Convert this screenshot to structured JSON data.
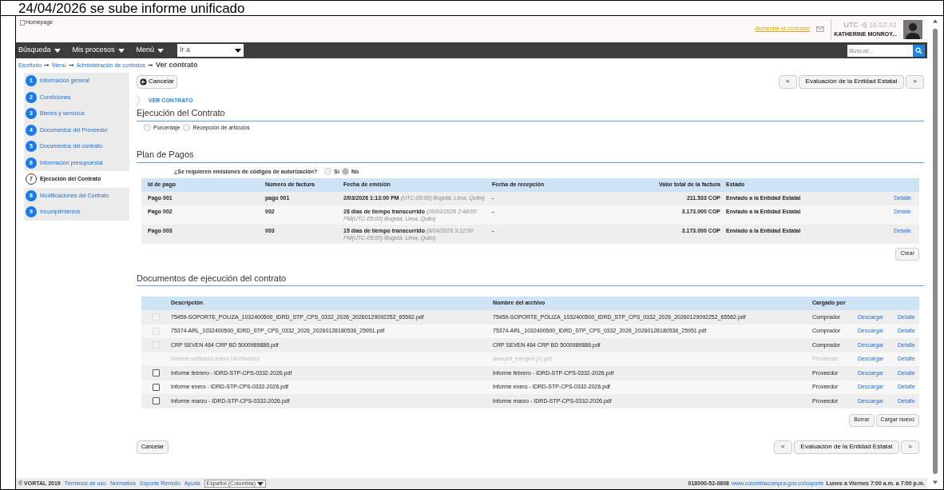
{
  "caption": "24/04/2026 se sube informe unificado",
  "header": {
    "logo_alt": "Homepage",
    "contrast_link": "Aumentar el contraste",
    "timezone": "UTC -5",
    "time": "16:52:41",
    "user": "KATHERINE MONROY..."
  },
  "nav": {
    "menus": [
      "Búsqueda",
      "Mis procesos",
      "Menú"
    ],
    "goto_value": "Ir a",
    "search_placeholder": "Buscar..."
  },
  "breadcrumb": {
    "separator": "➞",
    "links": [
      "Escritorio",
      "Menú",
      "Administración de contratos"
    ],
    "current": "Ver contrato"
  },
  "steps": [
    {
      "number": "1",
      "label": "Información general",
      "selected": false
    },
    {
      "number": "2",
      "label": "Condiciones",
      "selected": false
    },
    {
      "number": "3",
      "label": "Bienes y servicios",
      "selected": false
    },
    {
      "number": "4",
      "label": "Documentos del Proveedor",
      "selected": false
    },
    {
      "number": "5",
      "label": "Documentos del contrato",
      "selected": false
    },
    {
      "number": "6",
      "label": "Información presupuestal",
      "selected": false
    },
    {
      "number": "7",
      "label": "Ejecución del Contrato",
      "selected": true
    },
    {
      "number": "8",
      "label": "Modificaciones del Contrato",
      "selected": false
    },
    {
      "number": "9",
      "label": "Incumplimientos",
      "selected": false
    }
  ],
  "cancel_button": "Cancelar",
  "pager": {
    "prev": "<",
    "label": "Evaluación de la Entidad Estatal",
    "next": ">"
  },
  "section_tag": "VER CONTRATO",
  "execution": {
    "title": "Ejecución del Contrato",
    "options": [
      {
        "label": "Porcentaje",
        "selected": false
      },
      {
        "label": "Recepción de artículos",
        "selected": false
      }
    ]
  },
  "payments": {
    "title": "Plan de Pagos",
    "question": "¿Se requieren emisiones de códigos de autorización?",
    "answers": [
      {
        "label": "Sí",
        "selected": false
      },
      {
        "label": "No",
        "selected": true
      }
    ],
    "columns": [
      "Id de pago",
      "Número de factura",
      "Fecha de emisión",
      "Fecha de recepción",
      "Valor total de la factura",
      "Estado"
    ],
    "rows": [
      {
        "id": "Pago 001",
        "invoice": "pago 001",
        "issued": "2/03/2026 1:13:00 PM",
        "issued_note": "(UTC-05:00) Bogotá, Lima, Quito)",
        "received": "-",
        "total": "211.533 COP",
        "status": "Enviado a la Entidad Estatal",
        "link": "Detalle"
      },
      {
        "id": "Pago 002",
        "invoice": "002",
        "issued": "28 días de tiempo transcurrido",
        "issued_note": "(26/03/2026 2:48:00 PM(UTC-05:00) Bogotá, Lima, Quito)",
        "received": "-",
        "total": "3.173.000 COP",
        "status": "Enviado a la Entidad Estatal",
        "link": "Detalle"
      },
      {
        "id": "Pago 003",
        "invoice": "003",
        "issued": "15 días de tiempo transcurrido",
        "issued_note": "(8/04/2026 3:12:00 PM(UTC-05:00) Bogotá, Lima, Quito)",
        "received": "-",
        "total": "3.173.000 COP",
        "status": "Enviado a la Entidad Estatal",
        "link": "Detalle"
      }
    ],
    "create_button": "Crear"
  },
  "documents": {
    "title": "Documentos de ejecución del contrato",
    "columns": [
      "Descripción",
      "Nombre del archivo",
      "Cargado por"
    ],
    "rows": [
      {
        "kind": "checkbox",
        "checked": false,
        "disabled": true,
        "description": "75459-SOPORTE_POLIZA_1032400500_IDRD_STP_CPS_0332_2026_20260129092252_65562.pdf",
        "file": "75459-SOPORTE_POLIZA_1032400500_IDRD_STP_CPS_0332_2026_20260129092252_65562.pdf",
        "uploader": "Comprador",
        "download": "Descargar",
        "detail": "Detalle"
      },
      {
        "kind": "checkbox",
        "checked": false,
        "disabled": true,
        "description": "75374-ARL_1032400500_IDRD_STP_CPS_0332_2026_20260128180536_25951.pdf",
        "file": "75374-ARL_1032400500_IDRD_STP_CPS_0332_2026_20260128180536_25951.pdf",
        "uploader": "Comprador",
        "download": "Descargar",
        "detail": "Detalle"
      },
      {
        "kind": "checkbox",
        "checked": false,
        "disabled": true,
        "description": "CRP SEVEN 464 CRP BD 5000989886.pdf",
        "file": "CRP SEVEN 464 CRP BD 5000989886.pdf",
        "uploader": "Comprador",
        "download": "Descargar",
        "detail": "Detalle"
      },
      {
        "kind": "archived",
        "description": "informe unificado enero (Archivado)",
        "file": "ilovepdf_merged (3).pdf",
        "uploader": "Proveedor",
        "download": "Descargar",
        "detail": "Detalle"
      },
      {
        "kind": "checkbox",
        "checked": false,
        "disabled": false,
        "description": "Informe febrero - IDRD-STP-CPS-0332-2026.pdf",
        "file": "Informe febrero - IDRD-STP-CPS-0332-2026.pdf",
        "uploader": "Proveedor",
        "download": "Descargar",
        "detail": "Detalle"
      },
      {
        "kind": "checkbox",
        "checked": false,
        "disabled": false,
        "description": "Informe enero - IDRD-STP-CPS-0332-2026.pdf",
        "file": "Informe enero - IDRD-STP-CPS-0332-2026.pdf",
        "uploader": "Proveedor",
        "download": "Descargar",
        "detail": "Detalle"
      },
      {
        "kind": "checkbox",
        "checked": false,
        "disabled": false,
        "description": "Informe marzo - IDRD-STP-CPS-0332-2026.pdf",
        "file": "Informe marzo - IDRD-STP-CPS-0332-2026.pdf",
        "uploader": "Proveedor",
        "download": "Descargar",
        "detail": "Detalle"
      }
    ],
    "buttons": [
      "Borrar",
      "Cargar nuevo"
    ]
  },
  "bottom_cancel": "Cancelar",
  "bottom_pager": {
    "prev": "<",
    "label": "Evaluación de la Entidad Estatal",
    "next": ">"
  },
  "footer": {
    "copyright": "© VORTAL 2019",
    "links": [
      "Términos de uso",
      "Normativa",
      "Soporte Remoto",
      "Ayuda"
    ],
    "language": "Español (Colombia)",
    "phone": "018000-52-0808",
    "site": "www.colombiacompra.gov.co/soporte",
    "hours": "Lunes a Viernes 7:00 a.m. a 7:00 p.m."
  }
}
